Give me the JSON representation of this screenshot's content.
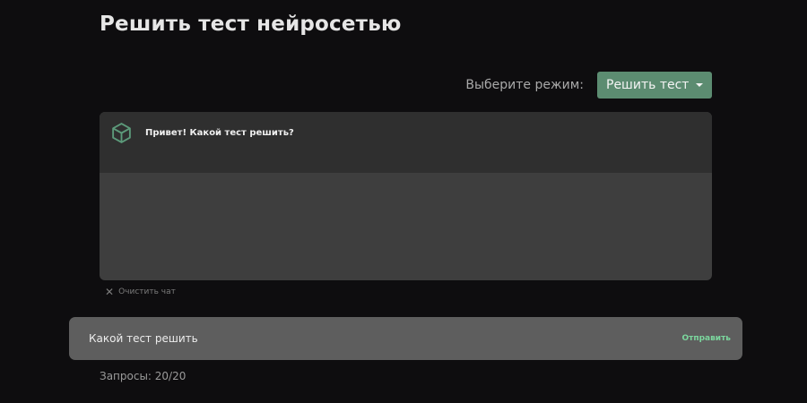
{
  "page": {
    "title": "Решить тест нейросетью"
  },
  "mode": {
    "label": "Выберите режим:",
    "selected": "Решить тест"
  },
  "chat": {
    "messages": [
      {
        "sender": "bot",
        "text": "Привет! Какой тест решить?"
      }
    ],
    "clear_label": "Очистить чат"
  },
  "input": {
    "value": "Какой тест решить",
    "send_label": "Отправить"
  },
  "requests": {
    "label": "Запросы: 20/20"
  },
  "colors": {
    "background": "#0e0d0f",
    "accent": "#5c8c71",
    "send": "#7bd69d"
  },
  "icons": {
    "bot_avatar": "cube-icon",
    "clear": "close-icon",
    "dropdown": "caret-down-icon"
  }
}
